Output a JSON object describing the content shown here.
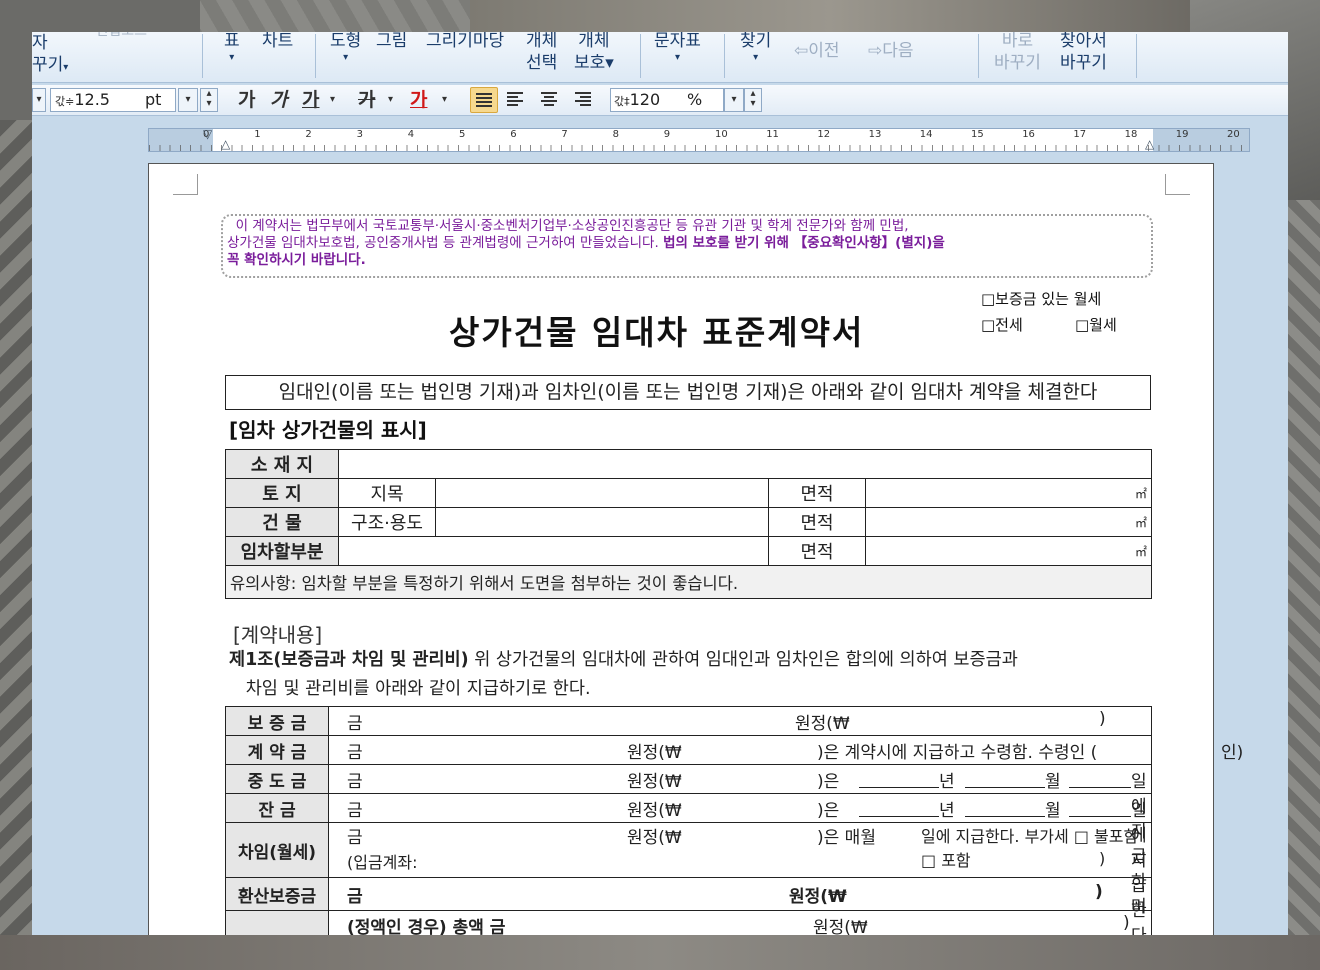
{
  "ribbon": {
    "partial_left_1": "자",
    "partial_left_2": "꾸기",
    "cutoff_top": "* 편집모드",
    "items": [
      {
        "label": "표",
        "arrow": "▾"
      },
      {
        "label": "차트",
        "arrow": ""
      },
      {
        "label": "도형",
        "arrow": "▾"
      },
      {
        "label": "그림",
        "arrow": ""
      },
      {
        "label": "그리기마당",
        "arrow": ""
      },
      {
        "label": "개체",
        "label2": "선택"
      },
      {
        "label": "개체",
        "label2": "보호▾"
      },
      {
        "label": "문자표",
        "arrow": "▾"
      },
      {
        "label": "찾기",
        "arrow": "▾"
      },
      {
        "label": "이전"
      },
      {
        "label": "다음"
      },
      {
        "label": "바로",
        "label2": "바꾸기"
      },
      {
        "label": "찾아서",
        "label2": "바꾸기"
      }
    ]
  },
  "format_bar": {
    "font_size_prefix": "갃≑",
    "font_size": "12.5",
    "unit": "pt",
    "bold": "가",
    "italic": "가",
    "underline": "가",
    "strike": "가",
    "color": "가",
    "line_spacing_icon": "갃‡",
    "line_spacing": "120",
    "line_spacing_unit": "%"
  },
  "ruler": {
    "numbers": [
      "0",
      "1",
      "2",
      "3",
      "4",
      "5",
      "6",
      "7",
      "8",
      "9",
      "10",
      "11",
      "12",
      "13",
      "14",
      "15",
      "16",
      "17",
      "18",
      "19",
      "20"
    ]
  },
  "document": {
    "notice_line1": "이 계약서는 법무부에서 국토교통부·서울시·중소벤처기업부·소상공인진흥공단 등 유관 기관 및 학계 전문가와 함께 민법,",
    "notice_line2_a": "상가건물 임대차보호법, 공인중개사법 등 관계법령에 근거하여 만들었습니다.",
    "notice_line2_b": "법의 보호를 받기 위해 【중요확인사항】(별지)을",
    "notice_line3": "꼭 확인하시기 바랍니다.",
    "choice1": "□보증금 있는 월세",
    "choice2": "□전세",
    "choice3": "□월세",
    "title": "상가건물 임대차 표준계약서",
    "intro": "임대인(이름 또는 법인명 기재)과 임차인(이름 또는 법인명 기재)은 아래와 같이 임대차 계약을 체결한다",
    "section1": "[임차 상가건물의 표시]",
    "property_table": {
      "location_label": "소 재 지",
      "land_label": "토    지",
      "land_sub": "지목",
      "building_label": "건    물",
      "building_sub": "구조·용도",
      "lease_part_label": "임차할부분",
      "area_label": "면적",
      "unit": "㎡",
      "note": "유의사항: 임차할 부분을 특정하기 위해서 도면을 첨부하는 것이 좋습니다."
    },
    "section2": "[계약내용]",
    "article1_title": "제1조(보증금과 차임 및 관리비)",
    "article1_body": " 위 상가건물의 임대차에 관하여 임대인과 임차인은 합의에 의하여 보증금과",
    "article1_body2": "차임 및 관리비를 아래와 같이 지급하기로 한다.",
    "payment_table": {
      "deposit_label": "보 증 금",
      "deposit_text_a": "금",
      "deposit_text_b": "원정(₩",
      "deposit_text_c": ")",
      "contract_label": "계 약 금",
      "contract_a": "금",
      "contract_b": "원정(₩",
      "contract_c": ")은 계약시에 지급하고 수령함. 수령인 (",
      "contract_d": "인)",
      "middle_label": "중 도 금",
      "middle_a": "금",
      "middle_b": "원정(₩",
      "middle_c": ")은",
      "year": "년",
      "month": "월",
      "day_pay": "일에 지급하며",
      "balance_label": "잔    금",
      "balance_a": "금",
      "balance_b": "원정(₩",
      "balance_c": ")은",
      "day_pay2": "일에 지급한다",
      "rent_label": "차임(월세)",
      "rent_a": "금",
      "rent_b": "원정(₩",
      "rent_c": ")은 매월",
      "rent_d": "일에 지급한다. 부가세 □ 불포함 □ 포함",
      "rent_account": "(입금계좌:",
      "rent_close": ")",
      "conv_label": "환산보증금",
      "conv_a": "금",
      "conv_b": "원정(₩",
      "conv_c": ")",
      "last_a": "(정액인 경우) 총액 금",
      "last_b": "원정(₩",
      "last_c": ")"
    }
  }
}
